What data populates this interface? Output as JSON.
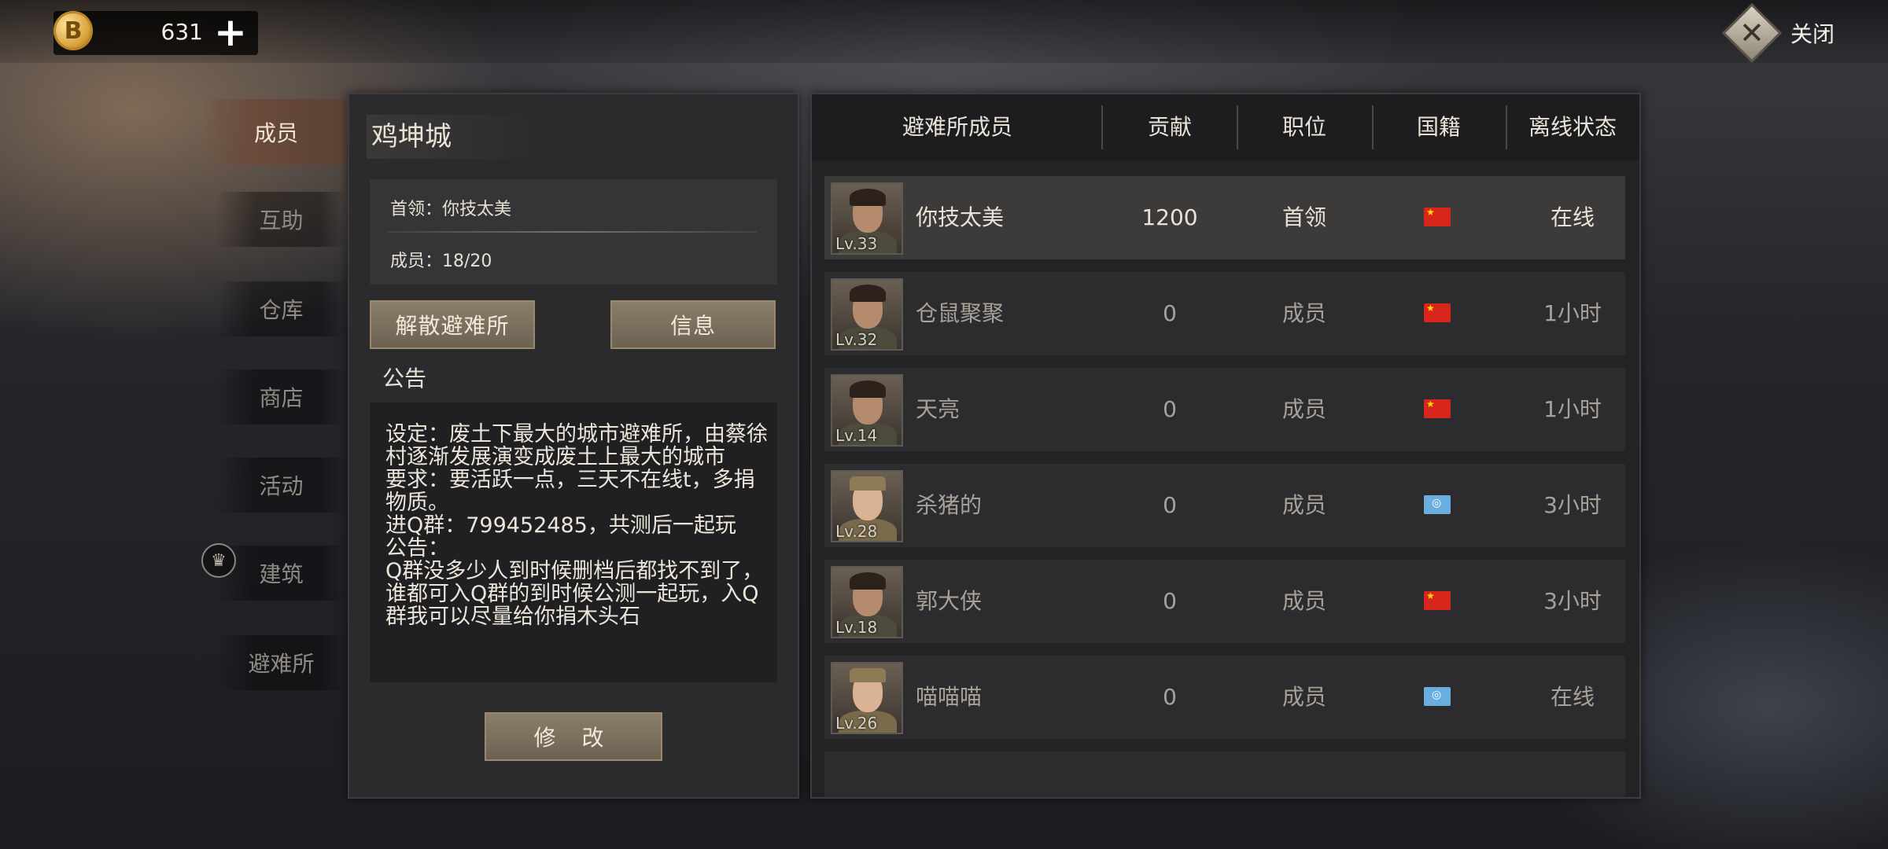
{
  "currency": {
    "icon": "coin-icon",
    "symbol": "B",
    "amount": "631",
    "add_label": "+"
  },
  "close": {
    "icon": "close-x-icon",
    "symbol": "✕",
    "label": "关闭"
  },
  "sidebar": {
    "items": [
      {
        "label": "成员",
        "active": true
      },
      {
        "label": "互助"
      },
      {
        "label": "仓库"
      },
      {
        "label": "商店"
      },
      {
        "label": "活动"
      },
      {
        "label": "建筑"
      },
      {
        "label": "避难所"
      }
    ],
    "crown_icon": "crown-icon",
    "crown_symbol": "♛"
  },
  "shelter": {
    "name": "鸡坤城",
    "leader": "首领：你技太美",
    "members": "成员：18/20",
    "disband_label": "解散避难所",
    "info_label": "信息",
    "notice_title": "公告",
    "notice_text": "设定：废土下最大的城市避难所，由蔡徐村逐渐发展演变成废土上最大的城市\n要求：要活跃一点，三天不在线t，多捐物质。\n进Q群：799452485，共测后一起玩\n公告：\nQ群没多少人到时候删档后都找不到了，谁都可入Q群的到时候公测一起玩，入Q群我可以尽量给你捐木头石",
    "edit_label": "修 改"
  },
  "table": {
    "headers": [
      "避难所成员",
      "贡献",
      "职位",
      "国籍",
      "离线状态"
    ],
    "rows": [
      {
        "level": "Lv.33",
        "name": "你技太美",
        "contribution": "1200",
        "role": "首领",
        "flag": "china-flag",
        "status": "在线",
        "avatar": "male"
      },
      {
        "level": "Lv.32",
        "name": "仓鼠聚聚",
        "contribution": "0",
        "role": "成员",
        "flag": "china-flag",
        "status": "1小时",
        "avatar": "male"
      },
      {
        "level": "Lv.14",
        "name": "天亮",
        "contribution": "0",
        "role": "成员",
        "flag": "china-flag",
        "status": "1小时",
        "avatar": "male"
      },
      {
        "level": "Lv.28",
        "name": "杀猪的",
        "contribution": "0",
        "role": "成员",
        "flag": "un-flag",
        "status": "3小时",
        "avatar": "female"
      },
      {
        "level": "Lv.18",
        "name": "郭大侠",
        "contribution": "0",
        "role": "成员",
        "flag": "china-flag",
        "status": "3小时",
        "avatar": "male"
      },
      {
        "level": "Lv.26",
        "name": "喵喵喵",
        "contribution": "0",
        "role": "成员",
        "flag": "un-flag",
        "status": "在线",
        "avatar": "female"
      }
    ]
  }
}
